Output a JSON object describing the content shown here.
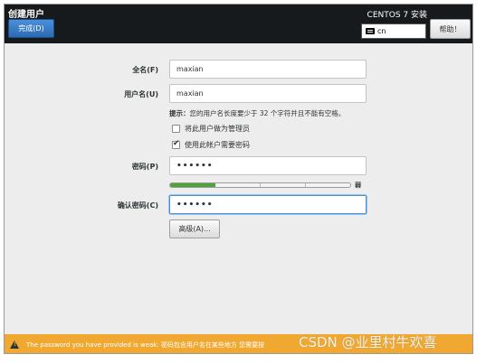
{
  "header": {
    "title": "创建用户",
    "done_label": "完成(D)",
    "product": "CENTOS 7 安装",
    "keyboard_layout": "cn",
    "help_label": "帮助！"
  },
  "form": {
    "fullname_label": "全名(F)",
    "fullname_value": "maxian",
    "username_label": "用户名(U)",
    "username_value": "maxian",
    "hint_prefix": "提示：",
    "hint_text": "您的用户名长度要少于 32 个字符并且不能有空格。",
    "admin_checkbox_label": "将此用户做为管理员",
    "admin_checked": false,
    "require_password_label": "使用此帐户需要密码",
    "require_password_checked": true,
    "password_label": "密码(P)",
    "password_value": "••••••",
    "strength_label": "弱",
    "strength_level": 0.25,
    "confirm_label": "确认密码(C)",
    "confirm_value": "••••••",
    "advanced_label": "高级(A)..."
  },
  "warning": {
    "text": "The password you have provided is weak: 密码包含用户名在某些地方 您需要按"
  },
  "watermark": "CSDN @业里村牛欢喜",
  "colors": {
    "header_bg": "#171a1d",
    "accent": "#4a90d9",
    "warning_bg": "#f0a830",
    "strength_fill": "#4fa33b"
  }
}
